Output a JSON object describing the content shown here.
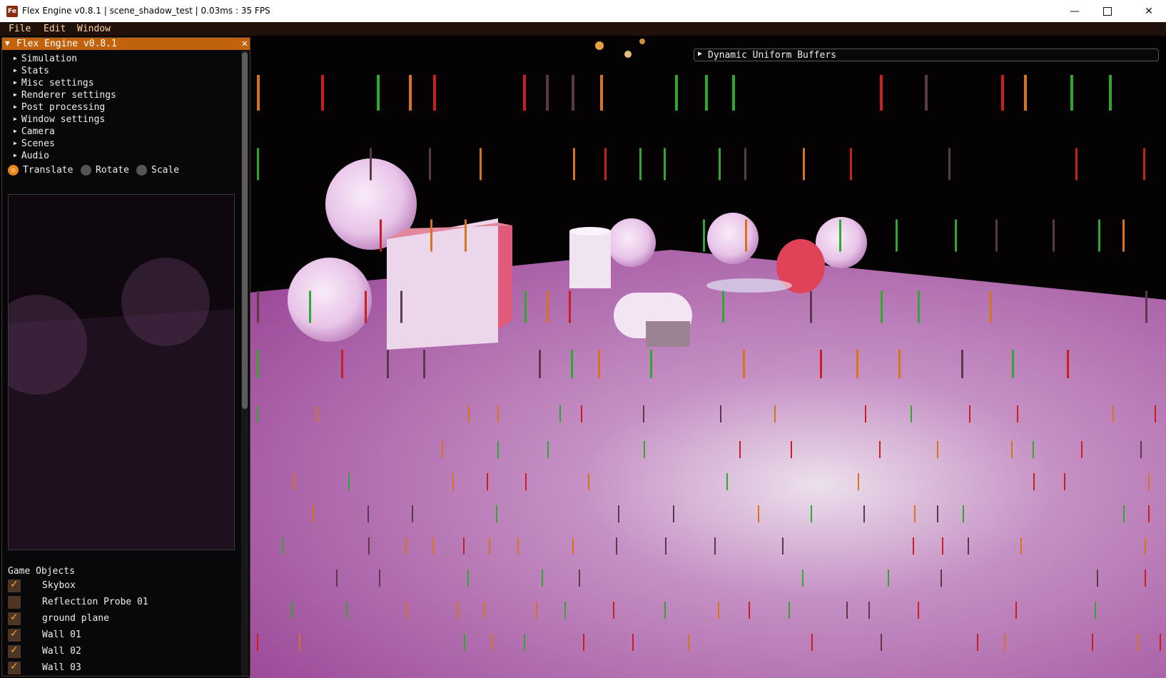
{
  "window": {
    "title": "Flex Engine v0.8.1 | scene_shadow_test | 0.03ms : 35 FPS",
    "icon_text": "Fe",
    "minimize_icon": "minimize-icon",
    "maximize_icon": "maximize-icon",
    "close_icon": "close-icon"
  },
  "menu": [
    "File",
    "Edit",
    "Window"
  ],
  "panel": {
    "title": "Flex Engine v0.8.1",
    "tree_items": [
      "Simulation",
      "Stats",
      "Misc settings",
      "Renderer settings",
      "Post processing",
      "Window settings",
      "Camera",
      "Scenes",
      "Audio"
    ],
    "transform_modes": [
      {
        "label": "Translate",
        "selected": true
      },
      {
        "label": "Rotate",
        "selected": false
      },
      {
        "label": "Scale",
        "selected": false
      }
    ],
    "game_objects_label": "Game Objects",
    "game_objects": [
      {
        "name": "Skybox",
        "checked": true
      },
      {
        "name": "Reflection Probe 01",
        "checked": false
      },
      {
        "name": "ground plane",
        "checked": true
      },
      {
        "name": "Wall 01",
        "checked": true
      },
      {
        "name": "Wall 02",
        "checked": true
      },
      {
        "name": "Wall 03",
        "checked": true
      }
    ]
  },
  "dynamic_uniform_buffers": {
    "label": "Dynamic Uniform Buffers",
    "expanded": false
  },
  "colors": {
    "accent": "#c1620c",
    "menu_text": "#ffd7a8",
    "floor": "#b569b0",
    "bar_red": "#c82020",
    "bar_green": "#2fa82f",
    "bar_orange": "#d6731b"
  }
}
